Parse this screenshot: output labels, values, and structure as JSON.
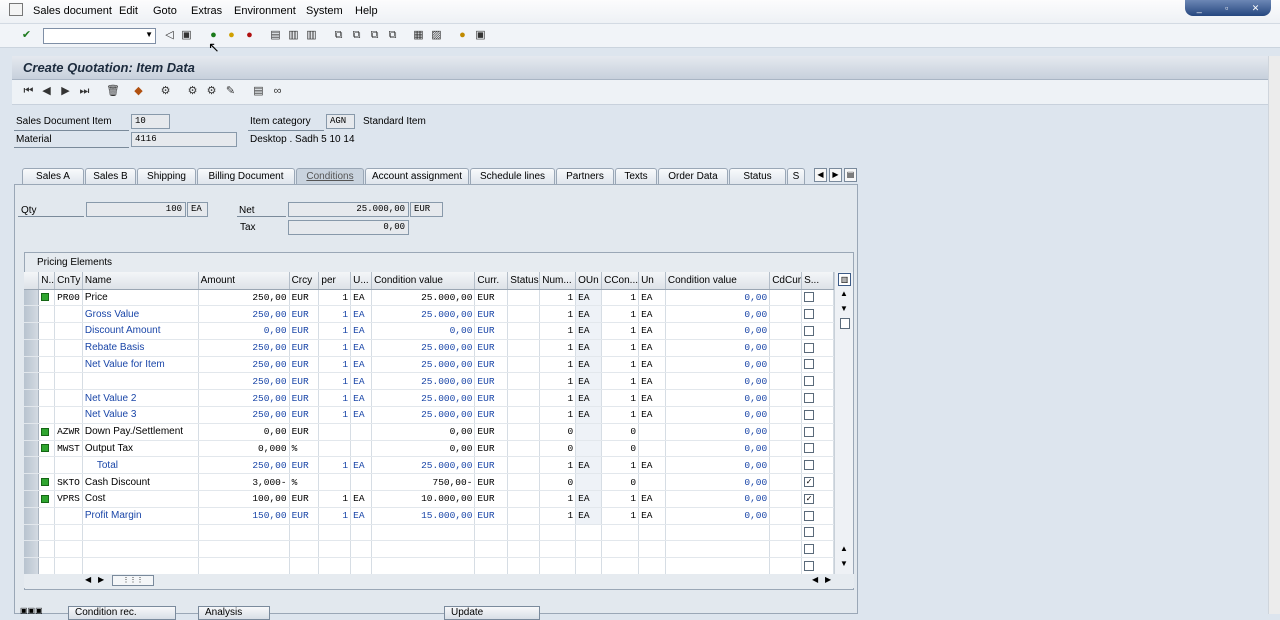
{
  "menubar": {
    "items": [
      "Sales document",
      "Edit",
      "Goto",
      "Extras",
      "Environment",
      "System",
      "Help"
    ]
  },
  "window_controls": [
    "_",
    "▫",
    "✕"
  ],
  "standard_toolbar": {
    "command_value": "",
    "icons": [
      "enter-icon",
      "back-icon",
      "save-icon",
      "back-green-icon",
      "exit-icon",
      "cancel-icon",
      "print-icon",
      "find-icon",
      "find-next-icon",
      "first-page-icon",
      "prev-page-icon",
      "next-page-icon",
      "last-page-icon",
      "new-session-icon",
      "shortcut-icon",
      "help-icon",
      "layout-icon"
    ]
  },
  "screen": {
    "title": "Create Quotation: Item Data"
  },
  "header": {
    "sales_doc_item_label": "Sales Document Item",
    "sales_doc_item_value": "10",
    "item_category_label": "Item category",
    "item_category_value": "AGN",
    "item_category_text": "Standard Item",
    "material_label": "Material",
    "material_value": "4116",
    "material_desc": "Desktop . Sadh 5 10 14"
  },
  "tabs": [
    {
      "label": "Sales A",
      "active": false
    },
    {
      "label": "Sales B",
      "active": false
    },
    {
      "label": "Shipping",
      "active": false
    },
    {
      "label": "Billing Document",
      "active": false
    },
    {
      "label": "Conditions",
      "active": true
    },
    {
      "label": "Account assignment",
      "active": false
    },
    {
      "label": "Schedule lines",
      "active": false
    },
    {
      "label": "Partners",
      "active": false
    },
    {
      "label": "Texts",
      "active": false
    },
    {
      "label": "Order Data",
      "active": false
    },
    {
      "label": "Status",
      "active": false
    },
    {
      "label": "S",
      "active": false
    }
  ],
  "conditions": {
    "qty_label": "Qty",
    "qty_value": "100",
    "qty_unit": "EA",
    "net_label": "Net",
    "net_value": "25.000,00",
    "net_currency": "EUR",
    "tax_label": "Tax",
    "tax_value": "0,00"
  },
  "pricing": {
    "group_title": "Pricing Elements",
    "columns": [
      "N..",
      "CnTy",
      "Name",
      "Amount",
      "Crcy",
      "per",
      "U...",
      "Condition value",
      "Curr.",
      "Status",
      "Num...",
      "OUn",
      "CCon...",
      "Un",
      "Condition value",
      "CdCur",
      "S..."
    ],
    "rows": [
      {
        "ind": true,
        "cnty": "PR00",
        "name": "Price",
        "amount": "250,00",
        "crcy": "EUR",
        "per": "1",
        "uom": "EA",
        "cond_value": "25.000,00",
        "curr": "EUR",
        "num": "1",
        "oun": "EA",
        "ccon": "1",
        "un": "EA",
        "cond_value2": "0,00",
        "stat": false,
        "sub": false,
        "editable": true
      },
      {
        "ind": false,
        "cnty": "",
        "name": "Gross Value",
        "amount": "250,00",
        "crcy": "EUR",
        "per": "1",
        "uom": "EA",
        "cond_value": "25.000,00",
        "curr": "EUR",
        "num": "1",
        "oun": "EA",
        "ccon": "1",
        "un": "EA",
        "cond_value2": "0,00",
        "stat": false,
        "sub": true
      },
      {
        "ind": false,
        "cnty": "",
        "name": "Discount Amount",
        "amount": "0,00",
        "crcy": "EUR",
        "per": "1",
        "uom": "EA",
        "cond_value": "0,00",
        "curr": "EUR",
        "num": "1",
        "oun": "EA",
        "ccon": "1",
        "un": "EA",
        "cond_value2": "0,00",
        "stat": false,
        "sub": true
      },
      {
        "ind": false,
        "cnty": "",
        "name": "Rebate Basis",
        "amount": "250,00",
        "crcy": "EUR",
        "per": "1",
        "uom": "EA",
        "cond_value": "25.000,00",
        "curr": "EUR",
        "num": "1",
        "oun": "EA",
        "ccon": "1",
        "un": "EA",
        "cond_value2": "0,00",
        "stat": false,
        "sub": true
      },
      {
        "ind": false,
        "cnty": "",
        "name": "Net Value for Item",
        "amount": "250,00",
        "crcy": "EUR",
        "per": "1",
        "uom": "EA",
        "cond_value": "25.000,00",
        "curr": "EUR",
        "num": "1",
        "oun": "EA",
        "ccon": "1",
        "un": "EA",
        "cond_value2": "0,00",
        "stat": false,
        "sub": true
      },
      {
        "ind": false,
        "cnty": "",
        "name": "",
        "amount": "250,00",
        "crcy": "EUR",
        "per": "1",
        "uom": "EA",
        "cond_value": "25.000,00",
        "curr": "EUR",
        "num": "1",
        "oun": "EA",
        "ccon": "1",
        "un": "EA",
        "cond_value2": "0,00",
        "stat": false,
        "sub": true
      },
      {
        "ind": false,
        "cnty": "",
        "name": "Net Value 2",
        "amount": "250,00",
        "crcy": "EUR",
        "per": "1",
        "uom": "EA",
        "cond_value": "25.000,00",
        "curr": "EUR",
        "num": "1",
        "oun": "EA",
        "ccon": "1",
        "un": "EA",
        "cond_value2": "0,00",
        "stat": false,
        "sub": true
      },
      {
        "ind": false,
        "cnty": "",
        "name": "Net Value 3",
        "amount": "250,00",
        "crcy": "EUR",
        "per": "1",
        "uom": "EA",
        "cond_value": "25.000,00",
        "curr": "EUR",
        "num": "1",
        "oun": "EA",
        "ccon": "1",
        "un": "EA",
        "cond_value2": "0,00",
        "stat": false,
        "sub": true
      },
      {
        "ind": true,
        "cnty": "AZWR",
        "name": "Down Pay./Settlement",
        "amount": "0,00",
        "crcy": "EUR",
        "per": "",
        "uom": "",
        "cond_value": "0,00",
        "curr": "EUR",
        "num": "0",
        "oun": "",
        "ccon": "0",
        "un": "",
        "cond_value2": "0,00",
        "stat": false,
        "sub": false
      },
      {
        "ind": true,
        "cnty": "MWST",
        "name": "Output Tax",
        "amount": "0,000",
        "crcy": "%",
        "per": "",
        "uom": "",
        "cond_value": "0,00",
        "curr": "EUR",
        "num": "0",
        "oun": "",
        "ccon": "0",
        "un": "",
        "cond_value2": "0,00",
        "stat": false,
        "sub": false
      },
      {
        "ind": false,
        "cnty": "",
        "name": "Total",
        "amount": "250,00",
        "crcy": "EUR",
        "per": "1",
        "uom": "EA",
        "cond_value": "25.000,00",
        "curr": "EUR",
        "num": "1",
        "oun": "EA",
        "ccon": "1",
        "un": "EA",
        "cond_value2": "0,00",
        "stat": false,
        "sub": true,
        "indent": true
      },
      {
        "ind": true,
        "cnty": "SKTO",
        "name": "Cash Discount",
        "amount": "3,000-",
        "crcy": "%",
        "per": "",
        "uom": "",
        "cond_value": "750,00-",
        "curr": "EUR",
        "num": "0",
        "oun": "",
        "ccon": "0",
        "un": "",
        "cond_value2": "0,00",
        "stat": true,
        "sub": false
      },
      {
        "ind": true,
        "cnty": "VPRS",
        "name": "Cost",
        "amount": "100,00",
        "crcy": "EUR",
        "per": "1",
        "uom": "EA",
        "cond_value": "10.000,00",
        "curr": "EUR",
        "num": "1",
        "oun": "EA",
        "ccon": "1",
        "un": "EA",
        "cond_value2": "0,00",
        "stat": true,
        "sub": false
      },
      {
        "ind": false,
        "cnty": "",
        "name": "Profit Margin",
        "amount": "150,00",
        "crcy": "EUR",
        "per": "1",
        "uom": "EA",
        "cond_value": "15.000,00",
        "curr": "EUR",
        "num": "1",
        "oun": "EA",
        "ccon": "1",
        "un": "EA",
        "cond_value2": "0,00",
        "stat": false,
        "sub": true
      }
    ],
    "empty_rows": 3
  },
  "bottom_buttons": [
    "Condition rec.",
    "Analysis",
    "Update"
  ]
}
